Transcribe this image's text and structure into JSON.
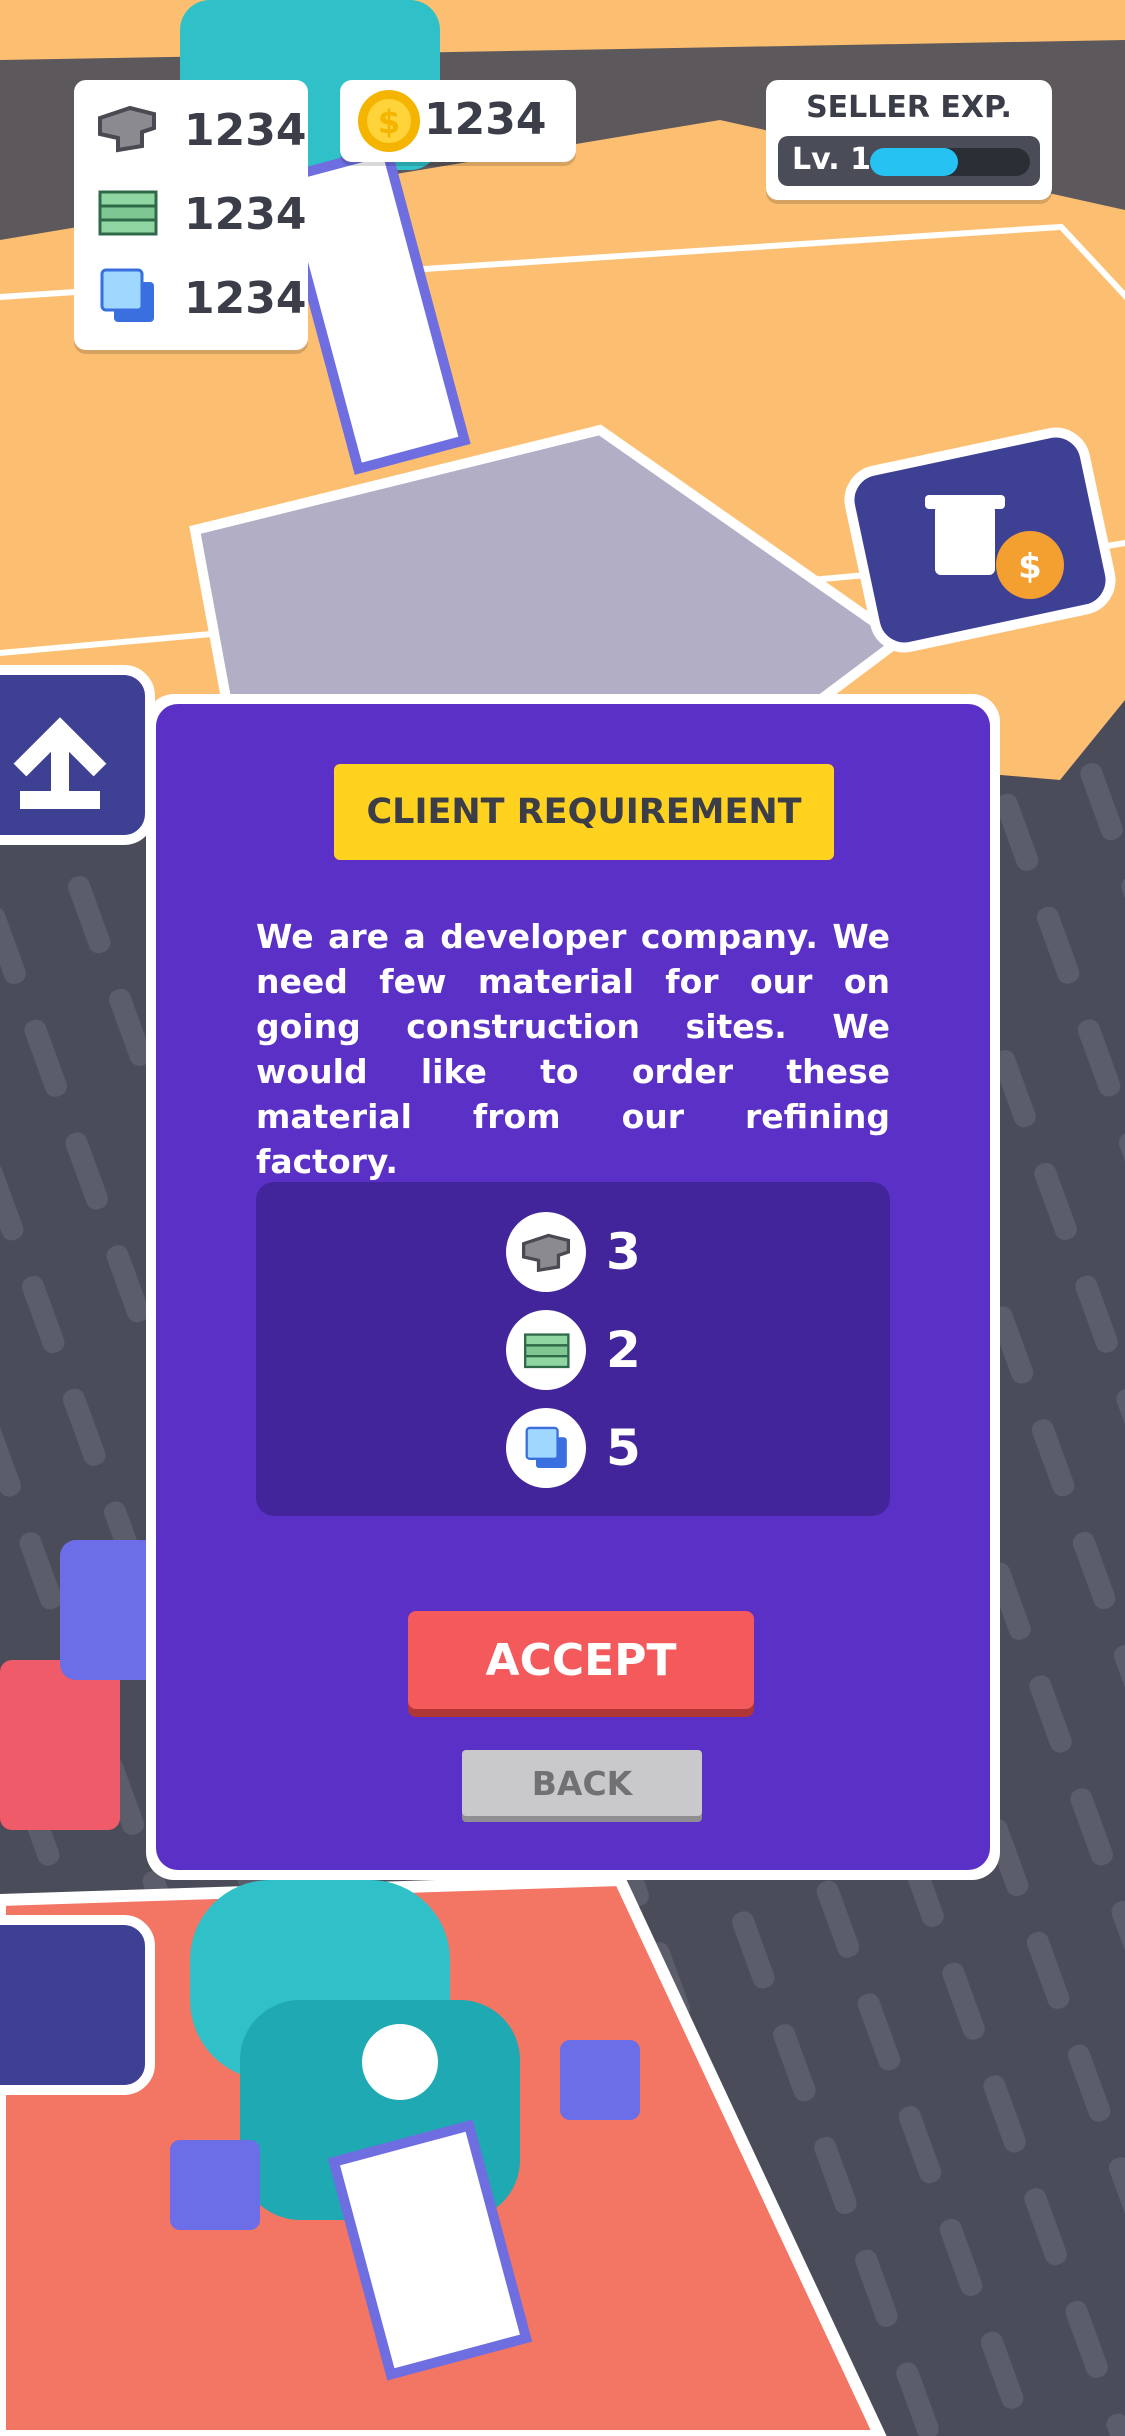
{
  "hud": {
    "resources": [
      {
        "icon": "iron-ingot-icon",
        "value": "1234"
      },
      {
        "icon": "cash-stack-icon",
        "value": "1234"
      },
      {
        "icon": "glass-pane-icon",
        "value": "1234"
      }
    ],
    "coins": {
      "icon": "coin-icon",
      "value": "1234"
    },
    "seller": {
      "title": "SELLER EXP.",
      "level": "Lv. 1",
      "progress": 0.55
    }
  },
  "modal": {
    "title": "CLIENT REQUIREMENT",
    "description": "We are a developer company. We need few material for our on going construction sites. We would like to order these material from our refining factory.",
    "requirements": [
      {
        "icon": "iron-ingot-icon",
        "qty": "3"
      },
      {
        "icon": "cash-stack-icon",
        "qty": "2"
      },
      {
        "icon": "glass-pane-icon",
        "qty": "5"
      }
    ],
    "accept_label": "ACCEPT",
    "back_label": "BACK"
  },
  "colors": {
    "modal_bg": "#5b30c6",
    "req_box": "#42259a",
    "badge": "#ffd21f",
    "accept": "#f4595b",
    "exp_fill": "#26c2f2"
  }
}
